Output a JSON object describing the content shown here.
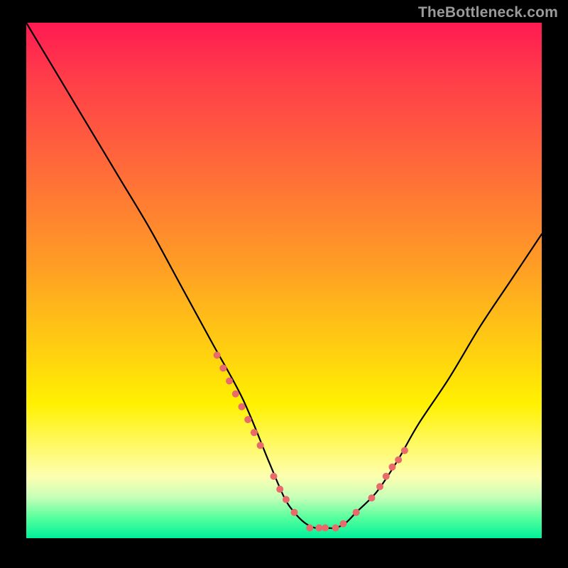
{
  "watermark": "TheBottleneck.com",
  "chart_data": {
    "type": "line",
    "title": "",
    "xlabel": "",
    "ylabel": "",
    "xlim": [
      0,
      100
    ],
    "ylim": [
      0,
      100
    ],
    "grid": false,
    "series": [
      {
        "name": "bottleneck-curve",
        "x": [
          0,
          6,
          12,
          18,
          24,
          30,
          36,
          42,
          47,
          50,
          52,
          54,
          56,
          58,
          60,
          62,
          64,
          68,
          72,
          76,
          82,
          88,
          94,
          100
        ],
        "values": [
          100,
          90,
          80,
          70,
          60,
          49,
          38,
          27,
          15,
          8,
          5,
          3,
          2,
          2,
          2,
          3,
          5,
          9,
          15,
          22,
          31,
          41,
          50,
          59
        ]
      }
    ],
    "markers": {
      "name": "highlight-points",
      "color": "#e86a6a",
      "radius": 5,
      "x": [
        37.0,
        38.2,
        39.4,
        40.6,
        41.8,
        43.0,
        44.2,
        45.4,
        48.0,
        49.2,
        50.4,
        52.0,
        55.0,
        56.8,
        58.0,
        60.0,
        61.5,
        64.0,
        67.0,
        68.6,
        69.8,
        71.0,
        72.2,
        73.4
      ],
      "values": [
        35.5,
        33.0,
        30.5,
        28.0,
        25.5,
        23.0,
        20.5,
        18.0,
        12.0,
        9.5,
        7.5,
        5.0,
        2.0,
        2.0,
        2.0,
        2.0,
        2.8,
        5.0,
        7.8,
        10.0,
        12.0,
        13.8,
        15.2,
        17.0
      ]
    },
    "background_gradient": {
      "top_color": "#ff1a52",
      "bottom_color": "#00f09a"
    }
  }
}
